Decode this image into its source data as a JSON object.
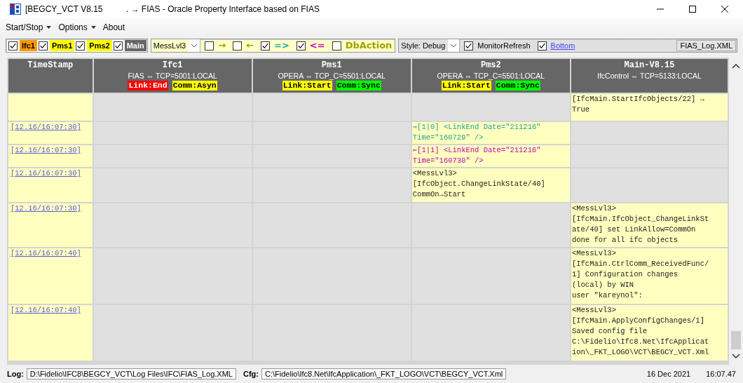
{
  "window": {
    "title": "[BEGCY_VCT V8.15          . → FIAS - Oracle Property Interface based on FIAS"
  },
  "menu": [
    {
      "label": "Start/Stop",
      "dropdown": true
    },
    {
      "label": "Options",
      "dropdown": true
    },
    {
      "label": "About",
      "dropdown": false
    }
  ],
  "toolbar": {
    "channels": [
      {
        "label": "Ifc1",
        "checked": true,
        "color": "#ff9900"
      },
      {
        "label": "Pms1",
        "checked": true,
        "color": "#ffff00"
      },
      {
        "label": "Pms2",
        "checked": true,
        "color": "#ffff00"
      },
      {
        "label": "Main",
        "checked": true,
        "color": "#666666"
      }
    ],
    "level_select": "MessLvl3",
    "filters": [
      {
        "label": "→",
        "checked": false,
        "color": "#a0a000"
      },
      {
        "label": "←",
        "checked": false,
        "color": "#a0a000"
      },
      {
        "label": "=>",
        "checked": true,
        "color": "#20a8a8"
      },
      {
        "label": "<=",
        "checked": true,
        "color": "#c000c0"
      },
      {
        "label": "DbAction",
        "checked": false,
        "color": "#a0a000"
      }
    ],
    "style_select": "Style: Debug",
    "monitor_refresh": {
      "label": "MonitorRefresh",
      "checked": true
    },
    "bottom": {
      "label": "Bottom",
      "checked": true
    },
    "log_button": "FIAS_Log.XML"
  },
  "table": {
    "columns": [
      {
        "title": "TimeStamp"
      },
      {
        "title": "Ifc1",
        "subtitle": "FIAS ⇔ TCP=5001:LOCAL",
        "tags": [
          {
            "label": "Link:End",
            "color": "#ff0000"
          },
          {
            "label": "Comm:Asyn",
            "color": "#ffff00"
          }
        ]
      },
      {
        "title": "Pms1",
        "subtitle": "OPERA ⇔ TCP_C=5501:LOCAL",
        "tags": [
          {
            "label": "Link:Start",
            "color": "#ffff00"
          },
          {
            "label": "Comm:Sync",
            "color": "#00ff00"
          }
        ]
      },
      {
        "title": "Pms2",
        "subtitle": "OPERA ⇔ TCP_C=5501:LOCAL",
        "tags": [
          {
            "label": "Link:Start",
            "color": "#ffff00"
          },
          {
            "label": "Comm:Sync",
            "color": "#00ff00"
          }
        ]
      },
      {
        "title": "Main-V8.15",
        "subtitle": "IfcControl ⇔ TCP=5133:LOCAL"
      }
    ],
    "rows": [
      {
        "cells": [
          "",
          "",
          "",
          "",
          {
            "kind": "msg",
            "text": "[IfcMain.StartIfcObjects/22] →\nTrue"
          }
        ]
      },
      {
        "cells": [
          "[12.16/16:07:30]",
          "",
          "",
          {
            "kind": "out",
            "text": "⇒[1|0] <LinkEnd Date=\"211216\"\nTime=\"160729\" />"
          },
          ""
        ]
      },
      {
        "cells": [
          "[12.16/16:07:30]",
          "",
          "",
          {
            "kind": "in",
            "text": "⇐[1|1] <LinkEnd Date=\"211216\"\nTime=\"160730\" />"
          },
          ""
        ]
      },
      {
        "cells": [
          "[12.16/16:07:30]",
          "",
          "",
          {
            "kind": "msg",
            "text": "<MessLvl3>\n[IfcObject.ChangeLinkState/40]\nCommOn→Start"
          },
          ""
        ]
      },
      {
        "cells": [
          "[12.16/16:07:30]",
          "",
          "",
          "",
          {
            "kind": "msg",
            "text": "<MessLvl3>\n[IfcMain.IfcObject_ChangeLinkSt\nate/40] set LinkAllow=CommOn\ndone for all ifc objects"
          }
        ]
      },
      {
        "cells": [
          "[12.16/16:07:40]",
          "",
          "",
          "",
          {
            "kind": "msg",
            "text": "<MessLvl3>\n[IfcMain.CtrlComm_ReceivedFunc/\n1] Configuration changes\n(local) by WIN\nuser \"kareynol\":"
          }
        ]
      },
      {
        "cells": [
          "[12.16/16:07:40]",
          "",
          "",
          "",
          {
            "kind": "msg",
            "text": "<MessLvl3>\n[IfcMain.ApplyConfigChanges/1]\nSaved config file\nC:\\Fidelio\\Ifc8.Net\\IfcApplicat\nion\\_FKT_LOGO\\VCT\\BEGCY_VCT.Xml"
          }
        ]
      }
    ]
  },
  "status_bar": {
    "log_label": "Log:",
    "log_path": "D:\\Fidelio\\IFC8\\BEGCY_VCT\\Log Files\\IFC\\FIAS_Log.XML",
    "cfg_label": "Cfg:",
    "cfg_path": "C:\\Fidelio\\Ifc8.Net\\IfcApplication\\_FKT_LOGO\\VCT\\BEGCY_VCT.Xml",
    "date": "16 Dec 2021",
    "time": "16:07.47"
  }
}
